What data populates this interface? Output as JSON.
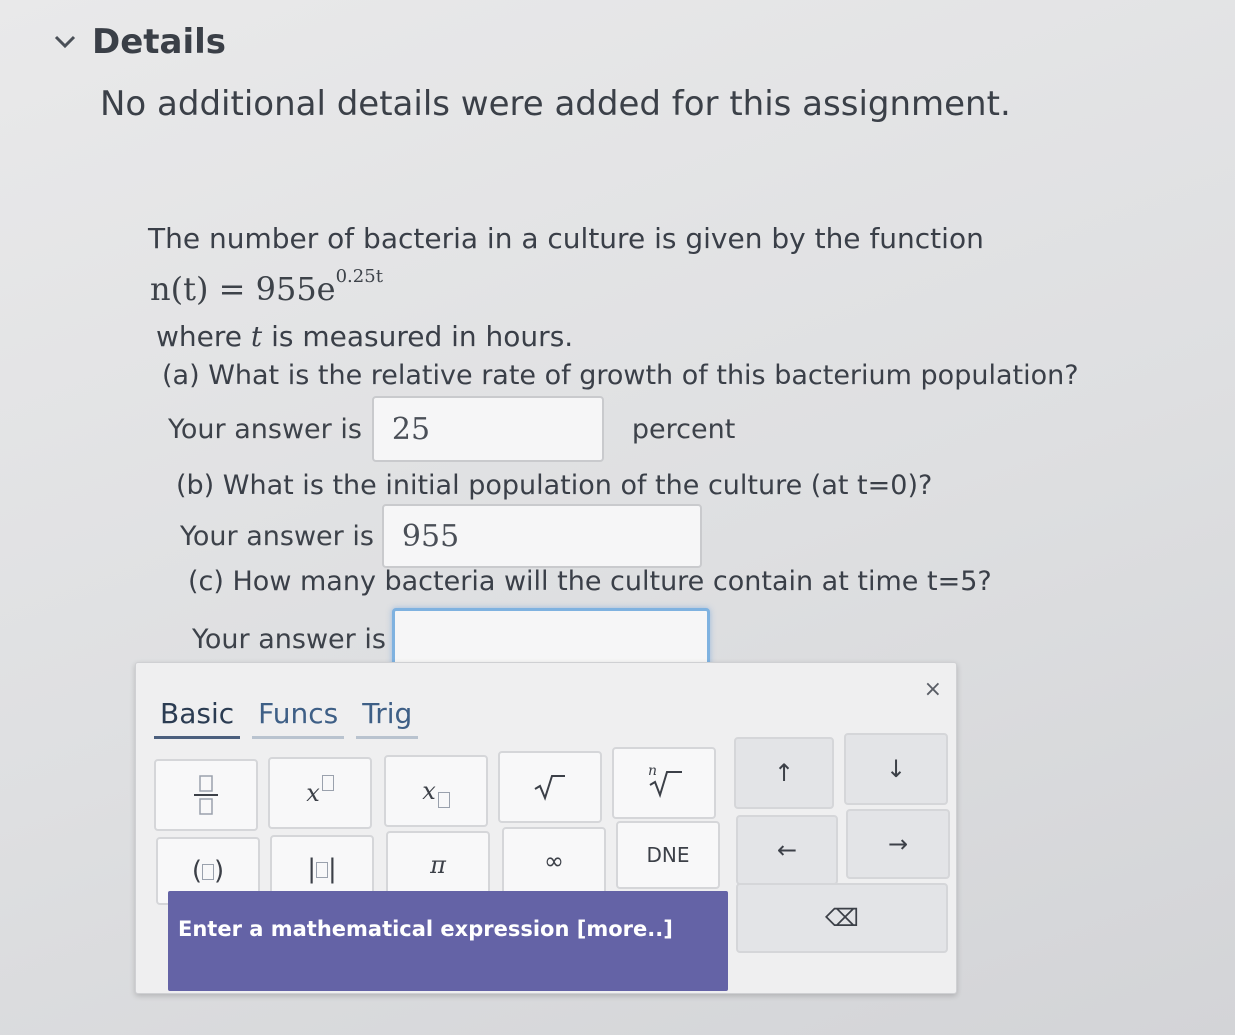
{
  "details": {
    "title": "Details",
    "text": "No additional details were added for this assignment."
  },
  "problem": {
    "intro": "The number of bacteria in a culture is given by the function",
    "formula_lhs": "n(t) = 955e",
    "formula_exp": "0.25t",
    "where_prefix": "where ",
    "where_var": "t",
    "where_suffix": " is measured in hours.",
    "part_a": {
      "question": "(a) What is the relative rate of growth of this bacterium population?",
      "label": "Your answer is",
      "value": "25",
      "unit": "percent"
    },
    "part_b": {
      "question": "(b) What is the initial population of the culture (at t=0)?",
      "label": "Your answer is",
      "value": "955"
    },
    "part_c": {
      "question": "(c) How many bacteria will the culture contain at time t=5?",
      "label": "Your answer is",
      "value": ""
    }
  },
  "keyboard": {
    "close": "×",
    "tabs": [
      "Basic",
      "Funcs",
      "Trig"
    ],
    "keys": {
      "x": "x",
      "pi": "π",
      "infinity": "∞",
      "dne": "DNE",
      "root_index": "n",
      "up": "↑",
      "down": "↓",
      "left": "←",
      "right": "→",
      "backspace": "⌫"
    },
    "hint": "Enter a mathematical expression [more..]"
  }
}
